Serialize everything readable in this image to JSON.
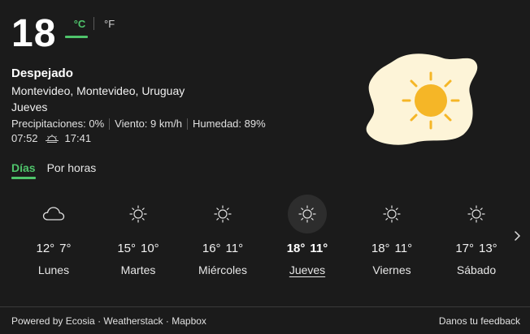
{
  "current": {
    "temperature": "18",
    "unit_celsius": "°C",
    "unit_fahrenheit": "°F",
    "condition": "Despejado",
    "location": "Montevideo, Montevideo, Uruguay",
    "day": "Jueves",
    "precipitation": "Precipitaciones: 0%",
    "wind": "Viento: 9 km/h",
    "humidity": "Humedad: 89%",
    "sunrise": "07:52",
    "sunset": "17:41",
    "hero_icon": "sun-icon"
  },
  "tabs": {
    "days": "Días",
    "hours": "Por horas",
    "active": "days"
  },
  "forecast": [
    {
      "day": "Lunes",
      "max": "12°",
      "min": "7°",
      "icon": "cloud-icon"
    },
    {
      "day": "Martes",
      "max": "15°",
      "min": "10°",
      "icon": "sun-icon"
    },
    {
      "day": "Miércoles",
      "max": "16°",
      "min": "11°",
      "icon": "sun-icon"
    },
    {
      "day": "Jueves",
      "max": "18°",
      "min": "11°",
      "icon": "sun-icon",
      "current": true
    },
    {
      "day": "Viernes",
      "max": "18°",
      "min": "11°",
      "icon": "sun-icon"
    },
    {
      "day": "Sábado",
      "max": "17°",
      "min": "13°",
      "icon": "sun-icon"
    }
  ],
  "footer": {
    "powered": "Powered by Ecosia",
    "dot1": " · ",
    "weatherstack": "Weatherstack",
    "dot2": " · ",
    "mapbox": "Mapbox",
    "feedback": "Danos tu feedback"
  },
  "colors": {
    "background": "#1b1b1b",
    "accent": "#4fc46b",
    "sun": "#f5b627",
    "hero_blob": "#fdf4d8"
  }
}
